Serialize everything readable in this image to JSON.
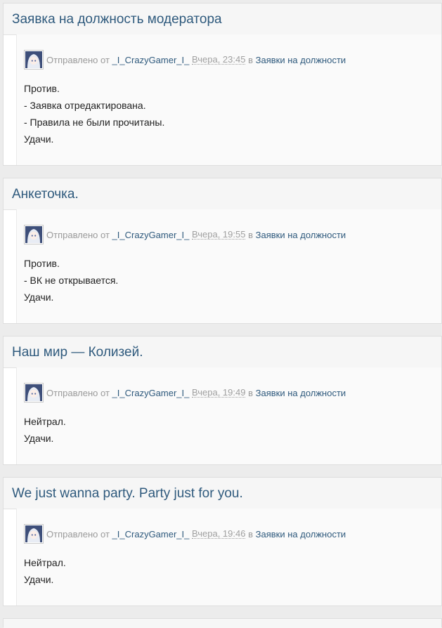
{
  "posts": [
    {
      "title": "Заявка на должность модератора",
      "sent_prefix": "Отправлено от",
      "author": "_I_CrazyGamer_I_",
      "date": "Вчера, 23:45",
      "in_word": "в",
      "forum": "Заявки на должности",
      "lines": [
        "Против.",
        "- Заявка отредактирована.",
        "- Правила не были прочитаны.",
        "Удачи."
      ]
    },
    {
      "title": "Анкеточка.",
      "sent_prefix": "Отправлено от",
      "author": "_I_CrazyGamer_I_",
      "date": "Вчера, 19:55",
      "in_word": "в",
      "forum": "Заявки на должности",
      "lines": [
        "Против.",
        "- ВК не открывается.",
        "Удачи."
      ]
    },
    {
      "title": "Наш мир — Колизей.",
      "sent_prefix": "Отправлено от",
      "author": "_I_CrazyGamer_I_",
      "date": "Вчера, 19:49",
      "in_word": "в",
      "forum": "Заявки на должности",
      "lines": [
        "Нейтрал.",
        "Удачи."
      ]
    },
    {
      "title": "We just wanna party. Party just for you.",
      "sent_prefix": "Отправлено от",
      "author": "_I_CrazyGamer_I_",
      "date": "Вчера, 19:46",
      "in_word": "в",
      "forum": "Заявки на должности",
      "lines": [
        "Нейтрал.",
        "Удачи."
      ]
    }
  ],
  "colors": {
    "accent": "#2f5a7d",
    "muted": "#9a9a9a",
    "background": "#ececec"
  },
  "icons": {
    "avatar": "anime-avatar-icon"
  }
}
